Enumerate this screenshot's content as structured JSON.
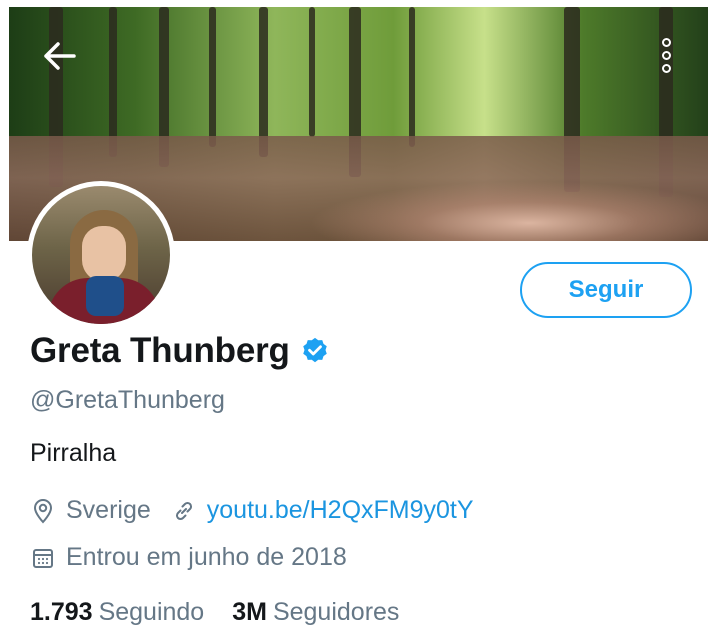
{
  "header": {
    "back_icon": "arrow-left-icon",
    "more_icon": "more-vertical-icon"
  },
  "profile": {
    "name": "Greta Thunberg",
    "verified": true,
    "handle": "@GretaThunberg",
    "bio": "Pirralha",
    "location": "Sverige",
    "link": "youtu.be/H2QxFM9y0tY",
    "joined": "Entrou em junho de 2018",
    "follow_label": "Seguir"
  },
  "stats": {
    "following_count": "1.793",
    "following_label": "Seguindo",
    "followers_count": "3M",
    "followers_label": "Seguidores"
  },
  "colors": {
    "accent": "#1da1f2",
    "link": "#1b95e0",
    "secondary_text": "#657786",
    "primary_text": "#14171a"
  }
}
